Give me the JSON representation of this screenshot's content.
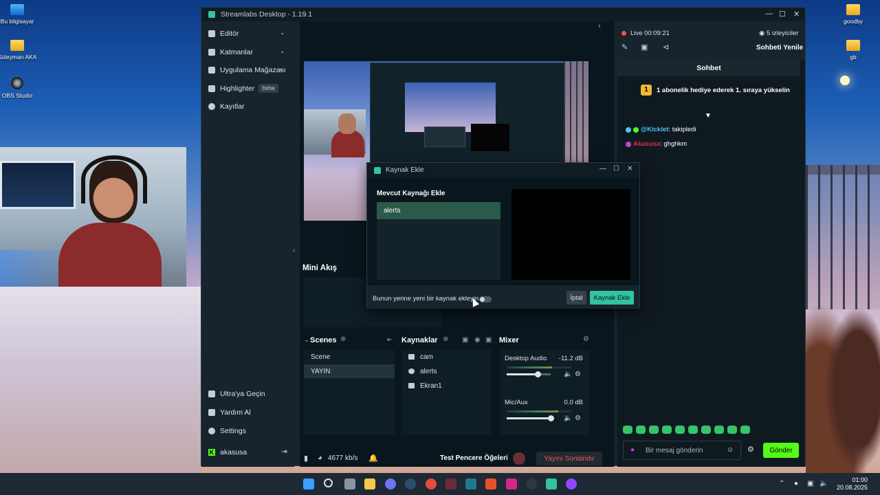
{
  "desktop": {
    "icons_left": [
      {
        "label": "Bu bilgisayar",
        "icon": "computer-icon"
      },
      {
        "label": "Süleyman AKA",
        "icon": "folder-icon"
      },
      {
        "label": "OBS Studio",
        "icon": "obs-icon"
      }
    ],
    "icons_right": [
      {
        "label": "goodby",
        "icon": "folder-icon"
      },
      {
        "label": "gb",
        "icon": "folder-icon"
      }
    ]
  },
  "app": {
    "title": "Streamlabs Desktop - 1.19.1",
    "window_controls": [
      "—",
      "☐",
      "✕"
    ],
    "sidebar": {
      "items": [
        {
          "label": "Editör",
          "icon": "editor-icon",
          "expandable": true
        },
        {
          "label": "Katmanlar",
          "icon": "layers-icon",
          "expandable": true
        },
        {
          "label": "Uygulama Mağazası",
          "icon": "store-icon",
          "expandable": true
        },
        {
          "label": "Highlighter",
          "icon": "highlighter-icon",
          "badge": "beta"
        },
        {
          "label": "Kayıtlar",
          "icon": "recordings-icon"
        }
      ],
      "bottom_items": [
        {
          "label": "Ultra'ya Geçin",
          "icon": "ultra-icon"
        },
        {
          "label": "Yardım Al",
          "icon": "help-icon"
        },
        {
          "label": "Settings",
          "icon": "gear-icon"
        }
      ],
      "account": {
        "label": "akasusa",
        "icon": "kick-logo-icon",
        "logout_icon": "logout-icon"
      }
    },
    "mini_stream": {
      "title": "Mini Akış"
    },
    "scenes": {
      "title": "Scenes",
      "items": [
        {
          "label": "Scene",
          "selected": false
        },
        {
          "label": "YAYIN",
          "selected": true
        }
      ]
    },
    "sources": {
      "title": "Kaynaklar",
      "items": [
        {
          "label": "cam",
          "icon": "webcam-icon"
        },
        {
          "label": "alerts",
          "icon": "alerts-icon"
        },
        {
          "label": "Ekran1",
          "icon": "display-icon"
        }
      ]
    },
    "mixer": {
      "title": "Mixer",
      "channels": [
        {
          "name": "Desktop Audio",
          "level": "-11.2 dB",
          "volume": 0.7
        },
        {
          "name": "Mic/Aux",
          "level": "0.0 dB",
          "volume": 1.0
        }
      ]
    },
    "statusbar": {
      "bitrate": "4677 kb/s",
      "test_widgets": "Test Pencere Öğeleri",
      "end_stream": "Yayını Sonlandır"
    },
    "chat": {
      "live_label": "Live 00:09:21",
      "viewers": "5 izleyiciler",
      "refresh": "Sohbeti Yenile",
      "title": "Sohbet",
      "promo": {
        "badge": "1",
        "text": "1 abonelik hediye ederek 1. sıraya yükselin"
      },
      "messages": [
        {
          "user": "@Kicklet",
          "text": ": takipledi",
          "user_color": "#4fc3f7"
        },
        {
          "user": "Akasusa",
          "text": ": ghghkm",
          "user_color": "#e0284e"
        }
      ],
      "input_placeholder": "Bir mesaj gönderin",
      "send": "Gönder"
    },
    "dialog": {
      "title": "Kaynak Ekle",
      "section": "Mevcut Kaynağı Ekle",
      "items": [
        "alerts"
      ],
      "toggle_label": "Bunun yerine yeni bir kaynak ekleyin",
      "cancel": "İptal",
      "add": "Kaynak Ekle"
    }
  },
  "taskbar": {
    "time": "01:00",
    "date": "20.08.2025",
    "apps": [
      "windows-icon",
      "search-icon",
      "taskview-icon",
      "explorer-icon",
      "discord-icon",
      "steam-icon",
      "chrome-icon",
      "vscode-icon",
      "app-icon",
      "brave-icon",
      "kick-icon",
      "obs-icon",
      "streamlabs-icon",
      "twitch-icon"
    ]
  },
  "colors": {
    "accent": "#31c3a2",
    "kick_green": "#53fc18",
    "danger": "#ff4f5a"
  }
}
